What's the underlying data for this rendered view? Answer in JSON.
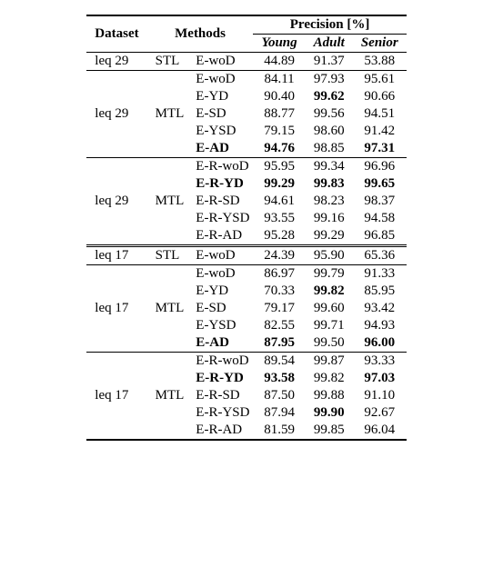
{
  "header": {
    "dataset": "Dataset",
    "methods": "Methods",
    "precision": "Precision",
    "precision_unit": "[%]",
    "young": "Young",
    "adult": "Adult",
    "senior": "Senior"
  },
  "blocks": [
    {
      "rows": [
        {
          "dataset": "leq 29",
          "type": "STL",
          "method": "E-woD",
          "young": "44.89",
          "adult": "91.37",
          "senior": "53.88",
          "bold": {}
        }
      ],
      "sep": "thin"
    },
    {
      "dataset": "leq 29",
      "type": "MTL",
      "rows": [
        {
          "method": "E-woD",
          "young": "84.11",
          "adult": "97.93",
          "senior": "95.61",
          "bold": {}
        },
        {
          "method": "E-YD",
          "young": "90.40",
          "adult": "99.62",
          "senior": "90.66",
          "bold": {
            "adult": true
          }
        },
        {
          "method": "E-SD",
          "young": "88.77",
          "adult": "99.56",
          "senior": "94.51",
          "bold": {}
        },
        {
          "method": "E-YSD",
          "young": "79.15",
          "adult": "98.60",
          "senior": "91.42",
          "bold": {}
        },
        {
          "method": "E-AD",
          "young": "94.76",
          "adult": "98.85",
          "senior": "97.31",
          "bold": {
            "method": true,
            "young": true,
            "senior": true
          }
        }
      ],
      "sep": "thin"
    },
    {
      "dataset": "leq 29",
      "type": "MTL",
      "rows": [
        {
          "method": "E-R-woD",
          "young": "95.95",
          "adult": "99.34",
          "senior": "96.96",
          "bold": {}
        },
        {
          "method": "E-R-YD",
          "young": "99.29",
          "adult": "99.83",
          "senior": "99.65",
          "bold": {
            "method": true,
            "young": true,
            "adult": true,
            "senior": true
          }
        },
        {
          "method": "E-R-SD",
          "young": "94.61",
          "adult": "98.23",
          "senior": "98.37",
          "bold": {}
        },
        {
          "method": "E-R-YSD",
          "young": "93.55",
          "adult": "99.16",
          "senior": "94.58",
          "bold": {}
        },
        {
          "method": "E-R-AD",
          "young": "95.28",
          "adult": "99.29",
          "senior": "96.85",
          "bold": {}
        }
      ],
      "sep": "double"
    },
    {
      "rows": [
        {
          "dataset": "leq 17",
          "type": "STL",
          "method": "E-woD",
          "young": "24.39",
          "adult": "95.90",
          "senior": "65.36",
          "bold": {}
        }
      ],
      "sep": "thin"
    },
    {
      "dataset": "leq 17",
      "type": "MTL",
      "rows": [
        {
          "method": "E-woD",
          "young": "86.97",
          "adult": "99.79",
          "senior": "91.33",
          "bold": {}
        },
        {
          "method": "E-YD",
          "young": "70.33",
          "adult": "99.82",
          "senior": "85.95",
          "bold": {
            "adult": true
          }
        },
        {
          "method": "E-SD",
          "young": "79.17",
          "adult": "99.60",
          "senior": "93.42",
          "bold": {}
        },
        {
          "method": "E-YSD",
          "young": "82.55",
          "adult": "99.71",
          "senior": "94.93",
          "bold": {}
        },
        {
          "method": "E-AD",
          "young": "87.95",
          "adult": "99.50",
          "senior": "96.00",
          "bold": {
            "method": true,
            "young": true,
            "senior": true
          }
        }
      ],
      "sep": "thin"
    },
    {
      "dataset": "leq 17",
      "type": "MTL",
      "rows": [
        {
          "method": "E-R-woD",
          "young": "89.54",
          "adult": "99.87",
          "senior": "93.33",
          "bold": {}
        },
        {
          "method": "E-R-YD",
          "young": "93.58",
          "adult": "99.82",
          "senior": "97.03",
          "bold": {
            "method": true,
            "young": true,
            "senior": true
          }
        },
        {
          "method": "E-R-SD",
          "young": "87.50",
          "adult": "99.88",
          "senior": "91.10",
          "bold": {}
        },
        {
          "method": "E-R-YSD",
          "young": "87.94",
          "adult": "99.90",
          "senior": "92.67",
          "bold": {
            "adult": true
          }
        },
        {
          "method": "E-R-AD",
          "young": "81.59",
          "adult": "99.85",
          "senior": "96.04",
          "bold": {}
        }
      ],
      "sep": "thick"
    }
  ]
}
